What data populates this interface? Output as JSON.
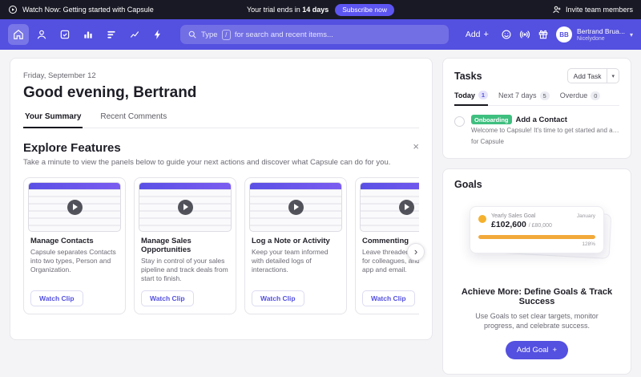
{
  "colors": {
    "brand_purple": "#5450e0",
    "topbar_bg": "#191925",
    "badge_green": "#3fbf7f",
    "goal_orange": "#f2a93b"
  },
  "icons": {
    "close": "×",
    "chevron_right": "›",
    "chevron_down": "▾",
    "plus": "+"
  },
  "topbar": {
    "watch_now": "Watch Now: Getting started with Capsule",
    "trial_prefix": "Your trial ends in",
    "trial_days": "14 days",
    "subscribe": "Subscribe now",
    "invite": "Invite team members"
  },
  "navbar": {
    "search": {
      "type_word": "Type",
      "slash_key": "/",
      "hint": "for search and recent items..."
    },
    "add_label": "Add",
    "user": {
      "initials": "BB",
      "name": "Bertrand Brua...",
      "org": "Nicelydone"
    }
  },
  "home": {
    "date": "Friday, September 12",
    "greeting": "Good evening, Bertrand",
    "tabs": [
      {
        "label": "Your Summary"
      },
      {
        "label": "Recent Comments"
      }
    ],
    "explore": {
      "title": "Explore Features",
      "subtitle": "Take a minute to view the panels below to guide your next actions and discover what Capsule can do for you.",
      "cards": [
        {
          "title": "Manage Contacts",
          "description": "Capsule separates Contacts into two types, Person and Organization.",
          "button": "Watch Clip"
        },
        {
          "title": "Manage Sales Opportunities",
          "description": "Stay in control of your sales pipeline and track deals from start to finish.",
          "button": "Watch Clip"
        },
        {
          "title": "Log a Note or Activity",
          "description": "Keep your team informed with detailed logs of interactions.",
          "button": "Watch Clip"
        },
        {
          "title": "Commenting",
          "description": "Leave threaded comments for colleagues, and more in app and email.",
          "button": "Watch Clip"
        }
      ]
    }
  },
  "tasks": {
    "title": "Tasks",
    "add_button": "Add Task",
    "tabs": [
      {
        "label": "Today",
        "count": "1"
      },
      {
        "label": "Next 7 days",
        "count": "5"
      },
      {
        "label": "Overdue",
        "count": "0"
      }
    ],
    "item": {
      "badge": "Onboarding",
      "title": "Add a Contact",
      "line1": "Welcome to Capsule! It's time to get started and ad...",
      "line2": "for Capsule"
    }
  },
  "goals": {
    "title": "Goals",
    "mini": {
      "label": "Yearly Sales Goal",
      "value": "£102,600",
      "target": "/ £80,000",
      "month": "January",
      "percent": "128%"
    },
    "heading": "Achieve More: Define Goals & Track Success",
    "description": "Use Goals to set clear targets, monitor progress, and celebrate success.",
    "add_button": "Add Goal"
  }
}
